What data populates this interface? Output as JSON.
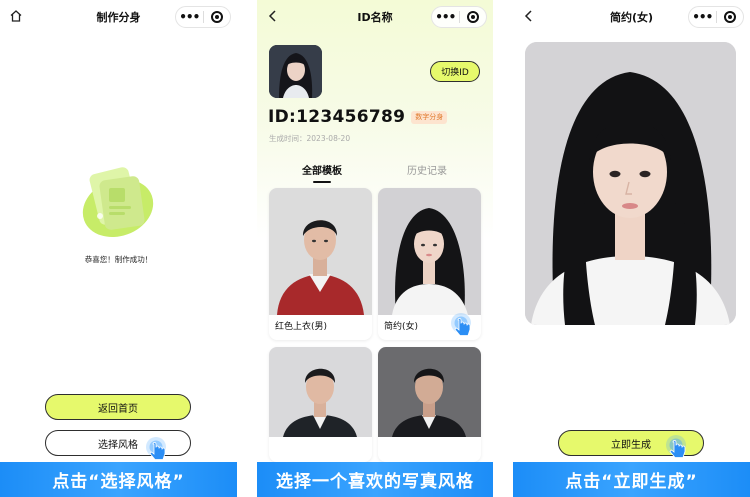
{
  "panel1": {
    "nav_title": "制作分身",
    "success_text": "恭喜您！制作成功！",
    "back_home_label": "返回首页",
    "choose_style_label": "选择风格",
    "banner": "点击“选择风格”"
  },
  "panel2": {
    "nav_title": "ID名称",
    "switch_id_label": "切换ID",
    "id_text": "ID:123456789",
    "id_badge": "数字分身",
    "gen_time": "生成时间：2023-08-20",
    "tabs": [
      {
        "label": "全部模板"
      },
      {
        "label": "历史记录"
      }
    ],
    "templates": [
      {
        "label": "红色上衣(男)"
      },
      {
        "label": "简约(女)"
      },
      {
        "label": ""
      },
      {
        "label": ""
      }
    ],
    "banner": "选择一个喜欢的写真风格"
  },
  "panel3": {
    "nav_title": "简约(女)",
    "generate_label": "立即生成",
    "banner": "点击“立即生成”"
  },
  "icons": {
    "home": "home-icon",
    "back": "chevron-left-icon",
    "more": "more-dots-icon",
    "target": "target-icon",
    "tap": "tap-hand-icon"
  },
  "colors": {
    "accent_green": "#e6f96c",
    "banner_blue": "#1c8df7",
    "badge_bg": "#fde4cf",
    "badge_text": "#e07a2d"
  }
}
